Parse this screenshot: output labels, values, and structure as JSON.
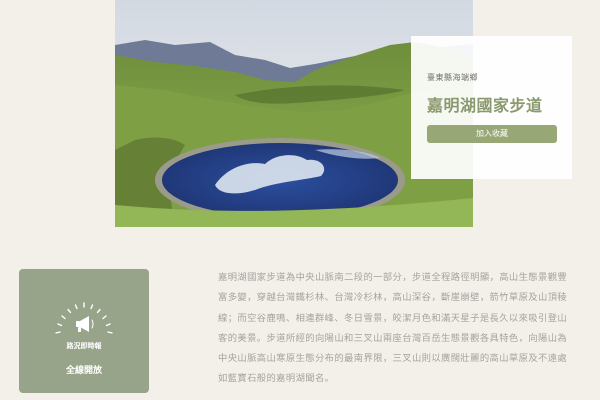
{
  "hero": {
    "image": "Jiaming Lake — blue alpine lake in green grassy basin with mountains"
  },
  "info_card": {
    "region": "臺東縣海端鄉",
    "title": "嘉明湖國家步道",
    "favorite_button": "加入收藏"
  },
  "status": {
    "icon": "megaphone-icon",
    "label": "路況即時報",
    "value": "全線開放"
  },
  "description": "嘉明湖國家步道為中央山脈南二段的一部分，步道全程路徑明顯，高山生態景觀豐富多變，穿越台灣鐵杉林、台灣冷杉林，高山深谷，斷崖崩壁，箭竹草原及山頂稜線；而空谷鹿鳴、相連群峰、冬日雪景，皎潔月色和滿天星子是長久以來吸引登山客的美景。步道所經的向陽山和三叉山兩座台灣百岳生態景觀各具特色，向陽山為中央山脈高山寒原生態分布的最南界限，三叉山則以廣闊壯麗的高山草原及不遠處如藍寶石般的嘉明湖聞名。",
  "colors": {
    "background": "#f3f0ea",
    "accent": "#97a776",
    "title": "#8a9a6e",
    "status_box": "#98a48a",
    "body_text": "#a3a39e"
  }
}
